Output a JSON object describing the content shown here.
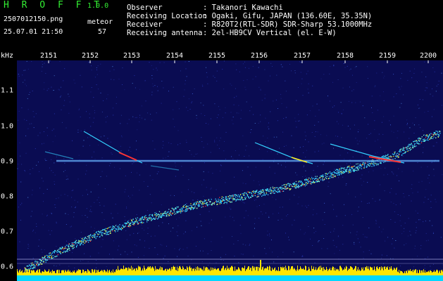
{
  "header": {
    "app_title": "H R O F F T",
    "app_version": "1.0.0",
    "file_name": "2507012150.png",
    "date_time": "25.07.01 21:50",
    "meteor_label": "meteor",
    "meteor_count": "57",
    "observer_label": "Observer",
    "observer_value": ": Takanori Kawachi",
    "location_label": "Receiving Location",
    "location_value": ": Ogaki, Gifu, JAPAN (136.60E, 35.35N)",
    "receiver_label": "Receiver",
    "receiver_value": ": R820T2(RTL-SDR) SDR-Sharp 53.1000MHz",
    "antenna_label": "Receiving antenna",
    "antenna_value": ": 2el-HB9CV Vertical (el. E-W)"
  },
  "axes": {
    "y_unit": "kHz",
    "x_ticks": [
      "2151",
      "2152",
      "2153",
      "2154",
      "2155",
      "2156",
      "2157",
      "2158",
      "2159",
      "2200"
    ],
    "y_ticks": [
      "1.1",
      "1.0",
      "0.9",
      "0.8",
      "0.7",
      "0.6"
    ]
  },
  "colors": {
    "background": "#0a0c52",
    "header_bg": "#000000",
    "title_green": "#33ee33",
    "carrier": "#8fe6ff",
    "signal_cyan": "#34d1ff",
    "signal_yellow": "#ffee22",
    "signal_red": "#ff3333",
    "bottom_bar": "#ffe600",
    "bottom_cyan": "#00d8ff"
  }
}
